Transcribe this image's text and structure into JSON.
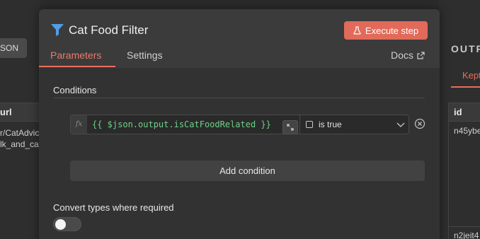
{
  "background": {
    "left_panel": {
      "json_button_label": "SON",
      "table_header": "url",
      "cells": [
        "r/CatAdvic",
        "lk_and_ca"
      ]
    },
    "right_panel": {
      "title": "OUTP",
      "tab_label": "Kept",
      "table_header": "id",
      "cells": [
        "n45ybe",
        "n2jeit4"
      ]
    }
  },
  "modal": {
    "title": "Cat Food Filter",
    "execute_button": "Execute step",
    "tabs": [
      {
        "label": "Parameters",
        "active": true
      },
      {
        "label": "Settings",
        "active": false
      }
    ],
    "docs_label": "Docs",
    "conditions": {
      "label": "Conditions",
      "items": [
        {
          "fx_label": "fx",
          "expression": "{{ $json.output.isCatFoodRelated }}",
          "operator": "is true"
        }
      ],
      "add_label": "Add condition"
    },
    "convert_types": {
      "label": "Convert types where required",
      "enabled": false
    }
  },
  "colors": {
    "accent": "#e26a5a",
    "expression": "#6fcf88"
  }
}
